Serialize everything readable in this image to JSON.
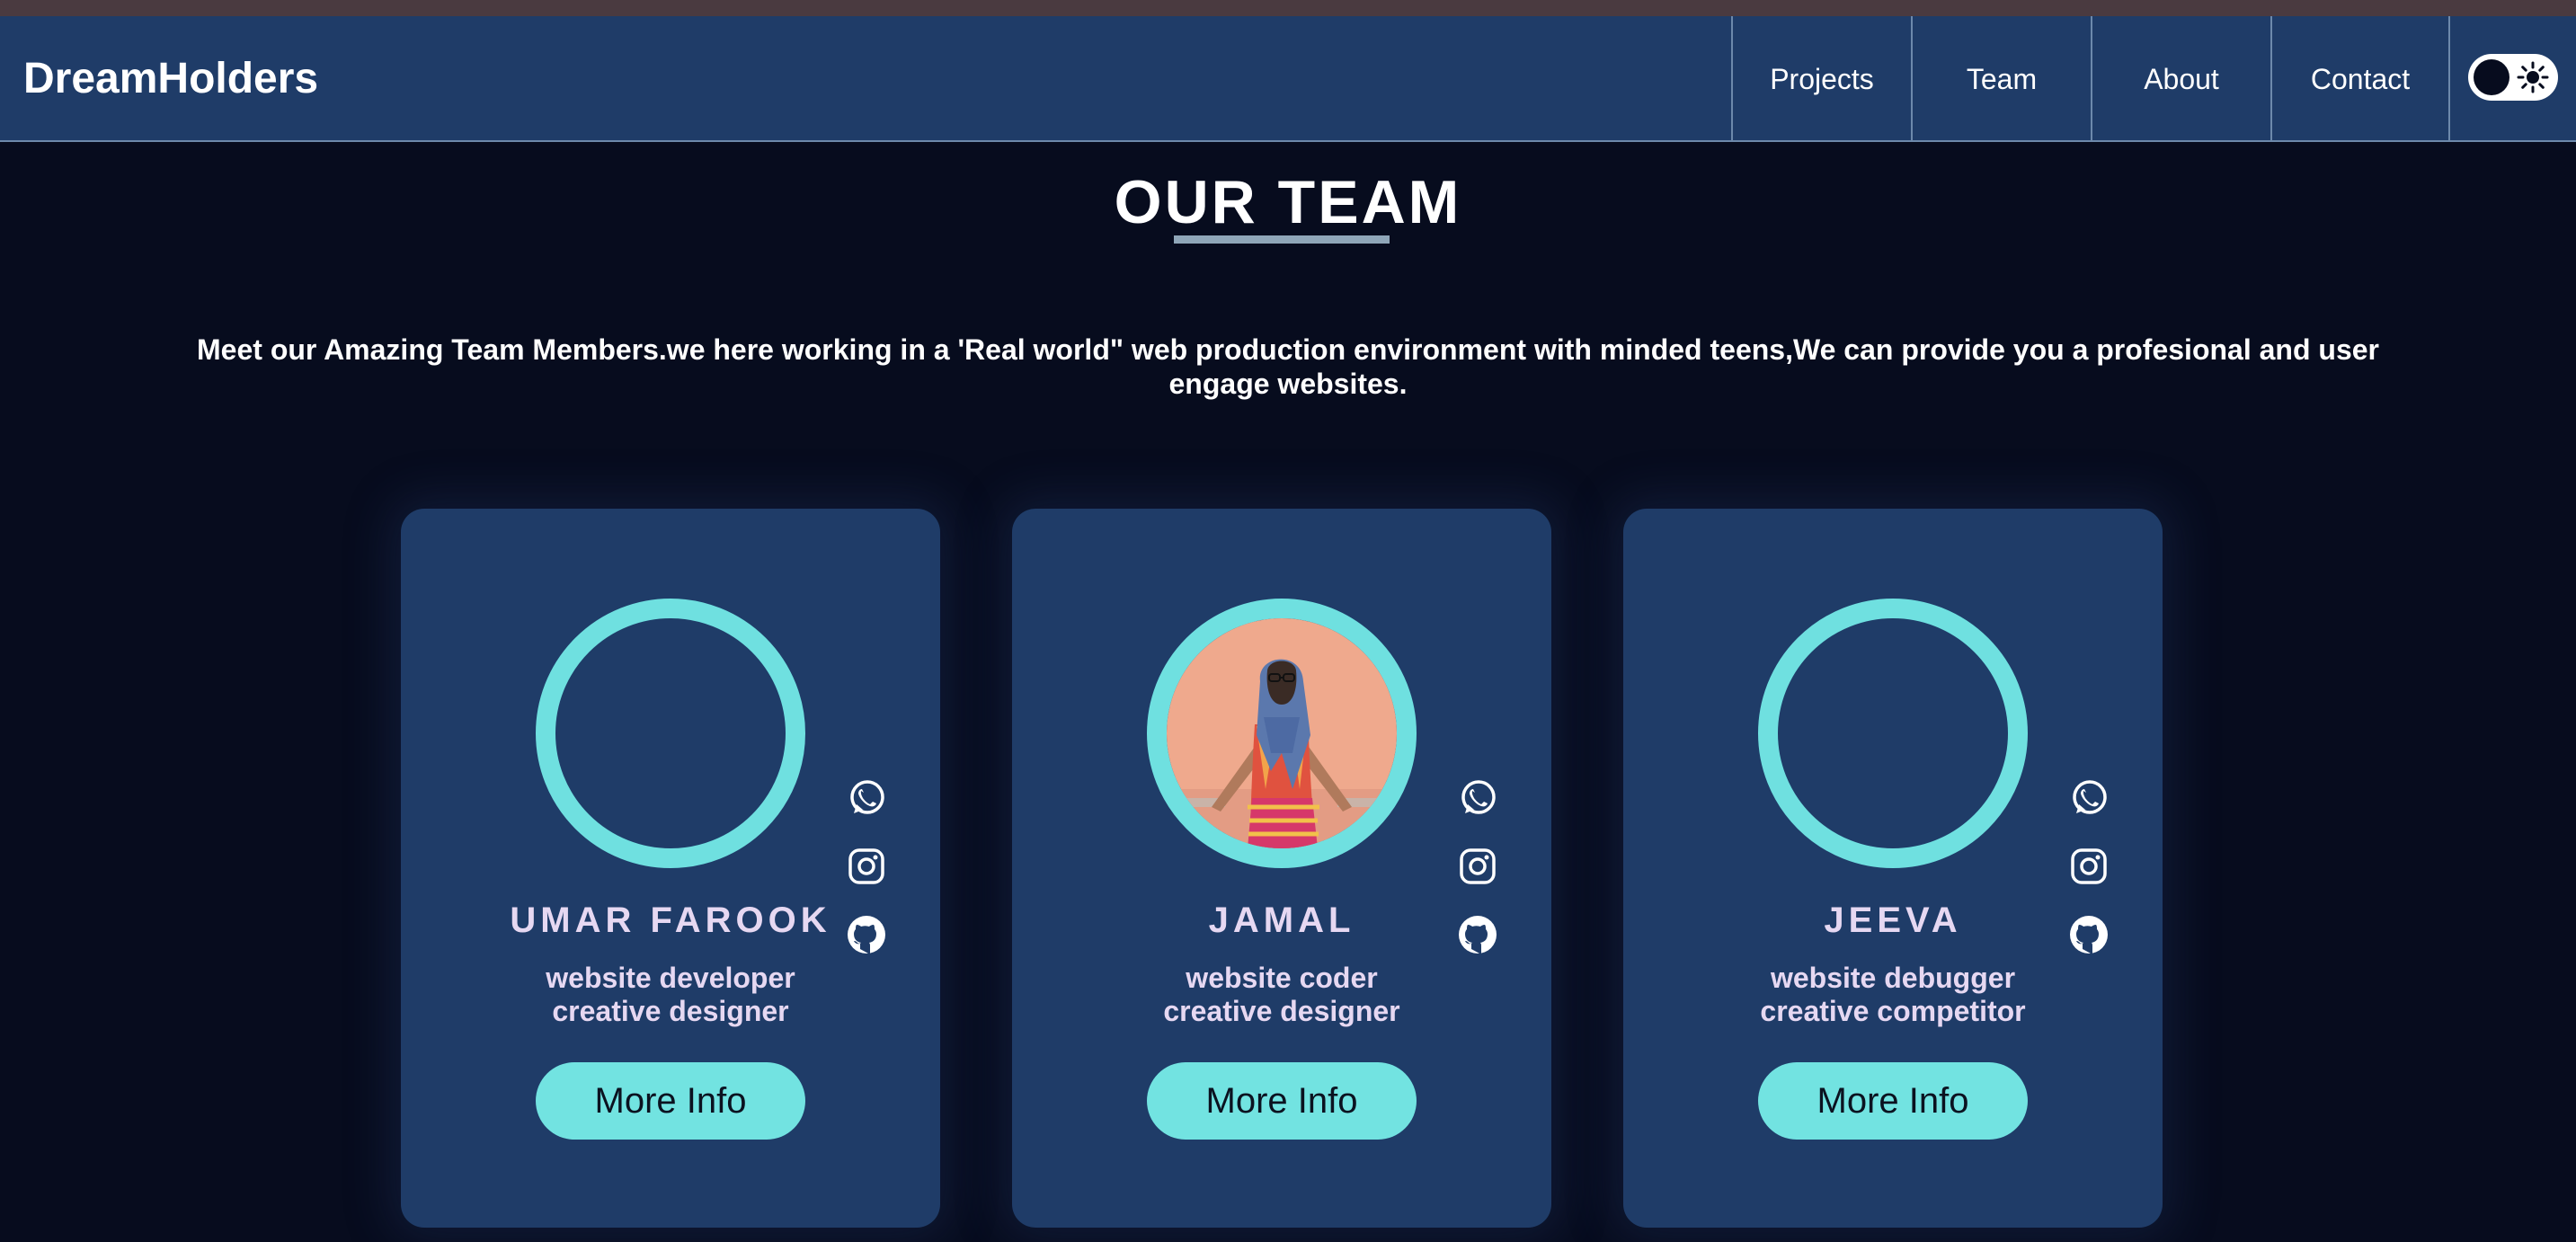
{
  "brand": "DreamHolders",
  "nav": {
    "links": [
      "Projects",
      "Team",
      "About",
      "Contact"
    ]
  },
  "theme_toggle": {
    "knob_icon": "moon-knob",
    "icon": "sun-icon"
  },
  "section": {
    "title": "OUR TEAM",
    "intro": "Meet our Amazing Team Members.we here working in a 'Real world\" web production environment with minded teens,We can provide you a profesional and user engage websites."
  },
  "team": [
    {
      "name": "UMAR FAROOK",
      "role_line1": "website developer",
      "role_line2": "creative designer",
      "button": "More Info",
      "has_photo": false
    },
    {
      "name": "JAMAL",
      "role_line1": "website coder",
      "role_line2": "creative designer",
      "button": "More Info",
      "has_photo": true
    },
    {
      "name": "JEEVA",
      "role_line1": "website debugger",
      "role_line2": "creative competitor",
      "button": "More Info",
      "has_photo": false
    }
  ],
  "social_icons": [
    "whatsapp-icon",
    "instagram-icon",
    "github-icon"
  ],
  "colors": {
    "page_bg": "#070c1e",
    "nav_bg": "#1f3c68",
    "card_bg": "#1f3c68",
    "accent": "#72e3e1",
    "name_text": "#e6d8f2"
  }
}
